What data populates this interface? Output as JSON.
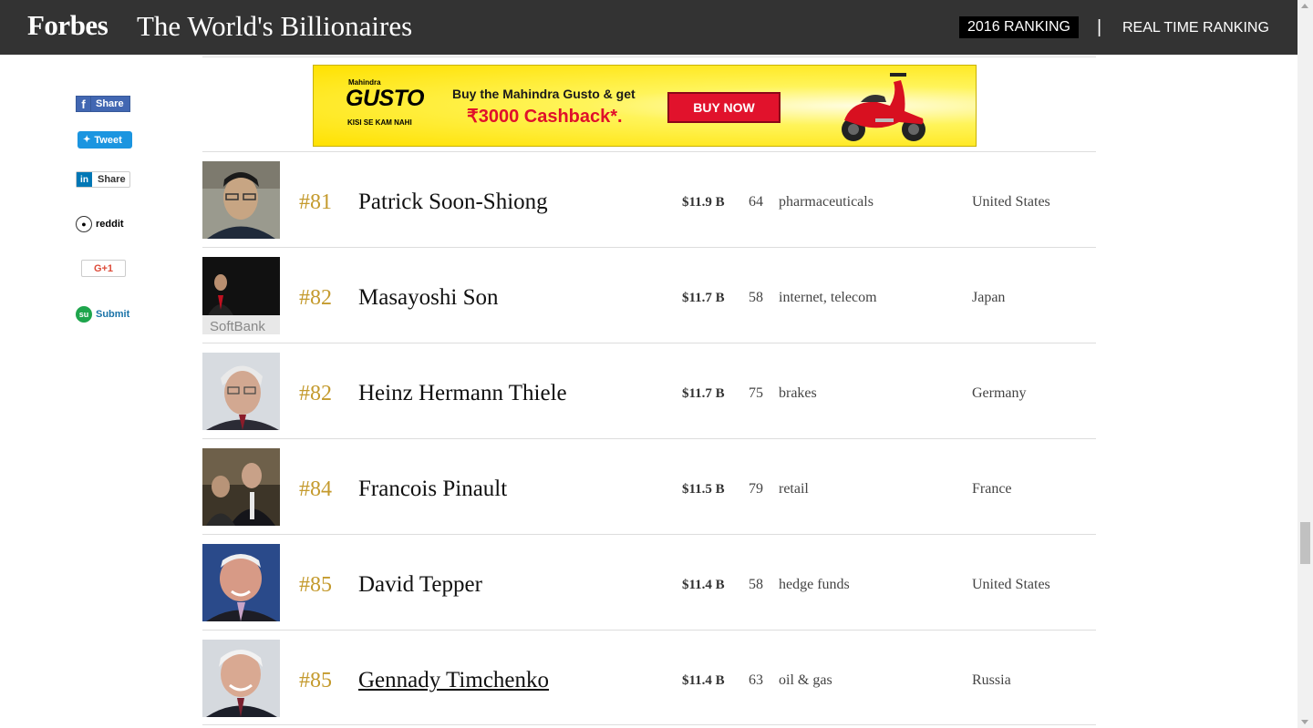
{
  "header": {
    "logo": "Forbes",
    "title": "The World's Billionaires",
    "nav_2016": "2016 RANKING",
    "nav_separator": "|",
    "nav_realtime": "REAL TIME RANKING"
  },
  "social": {
    "facebook": "Share",
    "twitter": "Tweet",
    "linkedin": "Share",
    "reddit": "reddit",
    "googleplus": "G+1",
    "stumbleupon": "Submit"
  },
  "ad": {
    "brand_small": "Mahindra",
    "brand": "GUSTO",
    "tagline": "KISI SE KAM NAHI",
    "line1": "Buy the Mahindra Gusto & get",
    "line2": "₹3000 Cashback*.",
    "button": "BUY NOW"
  },
  "billionaires": [
    {
      "rank": "#81",
      "name": "Patrick Soon-Shiong",
      "worth": "$11.9 B",
      "age": "64",
      "source": "pharmaceuticals",
      "country": "United States"
    },
    {
      "rank": "#82",
      "name": "Masayoshi Son",
      "worth": "$11.7 B",
      "age": "58",
      "source": "internet, telecom",
      "country": "Japan",
      "photo_caption": "SoftBank"
    },
    {
      "rank": "#82",
      "name": "Heinz Hermann Thiele",
      "worth": "$11.7 B",
      "age": "75",
      "source": "brakes",
      "country": "Germany"
    },
    {
      "rank": "#84",
      "name": "Francois Pinault",
      "worth": "$11.5 B",
      "age": "79",
      "source": "retail",
      "country": "France"
    },
    {
      "rank": "#85",
      "name": "David Tepper",
      "worth": "$11.4 B",
      "age": "58",
      "source": "hedge funds",
      "country": "United States"
    },
    {
      "rank": "#85",
      "name": "Gennady Timchenko",
      "worth": "$11.4 B",
      "age": "63",
      "source": "oil & gas",
      "country": "Russia"
    }
  ],
  "colors": {
    "header_bg": "#333333",
    "rank_gold": "#c49a2d",
    "ad_yellow": "#ffe100",
    "ad_red": "#e1122c"
  }
}
